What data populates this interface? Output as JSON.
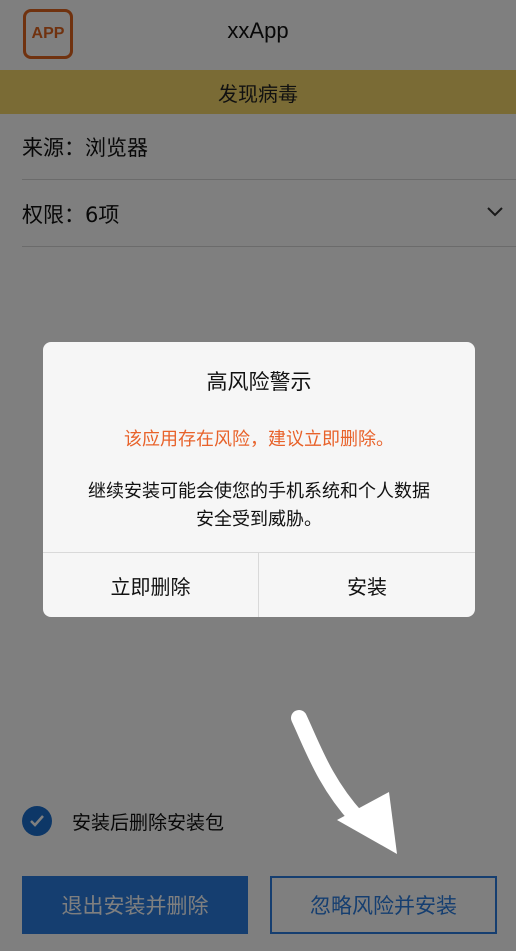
{
  "header": {
    "app_icon_text": "APP",
    "app_name": "xxApp"
  },
  "banner": {
    "text": "发现病毒"
  },
  "info": {
    "source": "来源：浏览器",
    "permissions": "权限：6项"
  },
  "options": {
    "delete_package_label": "安装后删除安装包",
    "delete_package_checked": true
  },
  "buttons": {
    "exit_delete": "退出安装并删除",
    "ignore_install": "忽略风险并安装"
  },
  "dialog": {
    "title": "高风险警示",
    "warning": "该应用存在风险，建议立即删除。",
    "body": "继续安装可能会使您的手机系统和个人数据安全受到威胁。",
    "delete_now": "立即删除",
    "install": "安装"
  },
  "colors": {
    "brand_orange": "#e0641e",
    "banner_yellow": "#f5d76a",
    "primary_blue": "#2a7de0",
    "warning_red": "#e8622a"
  }
}
